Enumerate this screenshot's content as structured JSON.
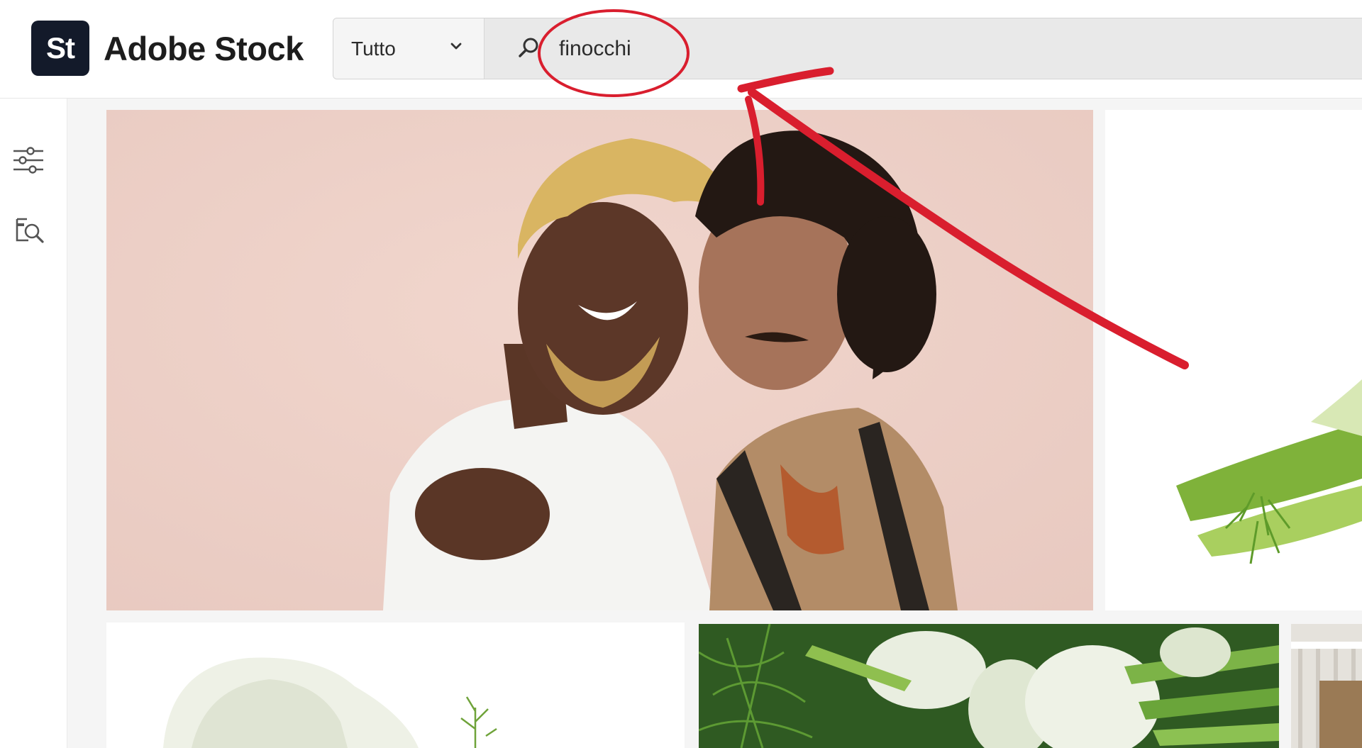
{
  "app": {
    "logo_text": "St",
    "brand_name": "Adobe Stock"
  },
  "search": {
    "scope": "Tutto",
    "query": "finocchi"
  },
  "icons": {
    "filters": "sliders-icon",
    "visual_search": "image-search-icon",
    "scope_chevron": "chevron-down-icon",
    "search": "search-icon"
  },
  "colors": {
    "annotation_red": "#d91e2e",
    "logo_bg": "#131a2a"
  },
  "results": [
    {
      "subject": "two men embracing, pink backdrop"
    },
    {
      "subject": "fennel stalks"
    },
    {
      "subject": "fennel bulb"
    },
    {
      "subject": "fennel bulbs with fronds"
    },
    {
      "subject": "balcony railing"
    }
  ]
}
